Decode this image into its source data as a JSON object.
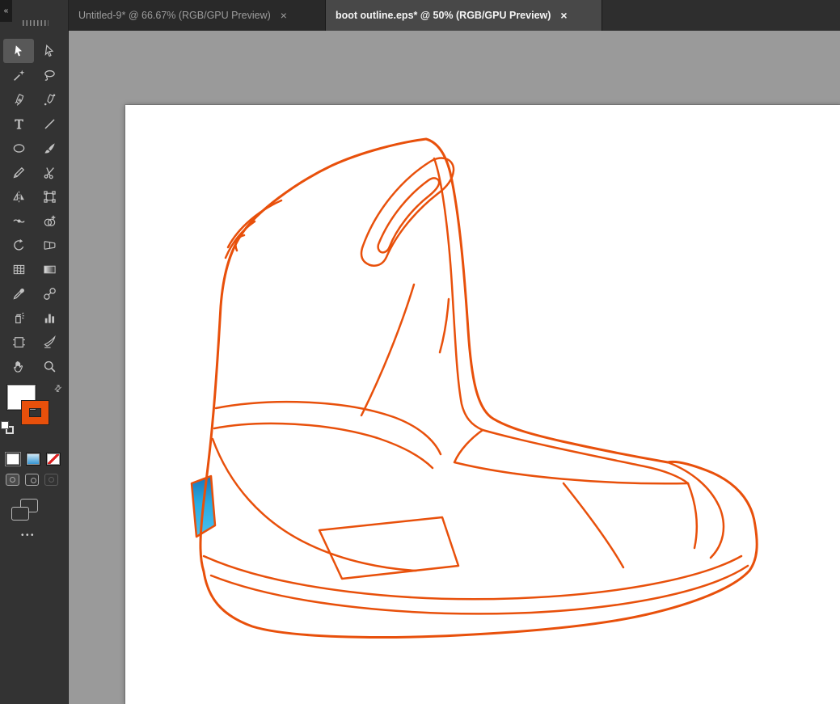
{
  "tabbar": {
    "tabs": [
      {
        "label": "Untitled-9* @ 66.67% (RGB/GPU Preview)",
        "close_glyph": "×",
        "active": false
      },
      {
        "label": "boot outline.eps* @ 50% (RGB/GPU Preview)",
        "close_glyph": "×",
        "active": true
      }
    ]
  },
  "toolbar": {
    "collapse_glyph": "«",
    "tools": [
      {
        "name": "selection-tool",
        "icon": "cursor_filled"
      },
      {
        "name": "direct-selection-tool",
        "icon": "cursor_open"
      },
      {
        "name": "magic-wand-tool",
        "icon": "wand"
      },
      {
        "name": "lasso-tool",
        "icon": "lasso"
      },
      {
        "name": "pen-tool",
        "icon": "pen"
      },
      {
        "name": "curvature-tool",
        "icon": "curvature"
      },
      {
        "name": "type-tool",
        "icon": "type"
      },
      {
        "name": "line-segment-tool",
        "icon": "line"
      },
      {
        "name": "ellipse-tool",
        "icon": "ellipse"
      },
      {
        "name": "paintbrush-tool",
        "icon": "brush"
      },
      {
        "name": "shaper-tool",
        "icon": "pencil"
      },
      {
        "name": "scissors-tool",
        "icon": "scissors"
      },
      {
        "name": "reflect-tool",
        "icon": "reflect"
      },
      {
        "name": "free-transform-tool",
        "icon": "transform"
      },
      {
        "name": "width-tool",
        "icon": "width"
      },
      {
        "name": "shape-builder-tool",
        "icon": "shapebuilder"
      },
      {
        "name": "rotate-view-tool",
        "icon": "rotateview"
      },
      {
        "name": "perspective-grid-tool",
        "icon": "perspective"
      },
      {
        "name": "mesh-tool",
        "icon": "mesh"
      },
      {
        "name": "gradient-tool",
        "icon": "gradient"
      },
      {
        "name": "eyedropper-tool",
        "icon": "eyedropper"
      },
      {
        "name": "blend-tool",
        "icon": "blend"
      },
      {
        "name": "symbol-sprayer-tool",
        "icon": "sprayer"
      },
      {
        "name": "column-graph-tool",
        "icon": "graph"
      },
      {
        "name": "artboard-tool",
        "icon": "artboard"
      },
      {
        "name": "slice-tool",
        "icon": "slice"
      },
      {
        "name": "hand-tool",
        "icon": "hand"
      },
      {
        "name": "zoom-tool",
        "icon": "zoom"
      }
    ],
    "color_widget": {
      "fill_color": "#FFFFFF",
      "stroke_color": "#E8500B",
      "swap_glyph": "⇄"
    },
    "more_label": "•••"
  },
  "canvas": {
    "pasteboard_color": "#9a9a9a",
    "artboard_color": "#ffffff",
    "artwork": {
      "stroke_color": "#E8500B",
      "accent_fill_color": "#29ABE2"
    }
  }
}
